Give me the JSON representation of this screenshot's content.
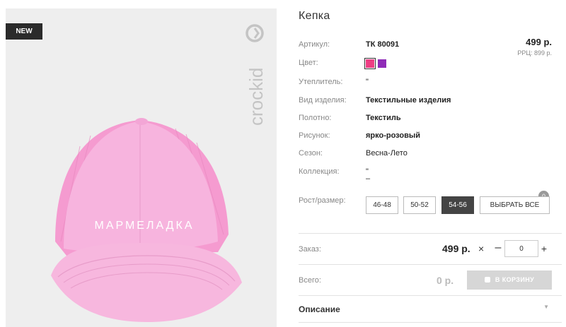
{
  "product": {
    "badge": "NEW",
    "brand_logo_text": "crockid",
    "cap_print_text": "МАРМЕЛАДКА",
    "title": "Кепка",
    "price": "499 р.",
    "rrp": "РРЦ: 899 р."
  },
  "specs": {
    "article": {
      "label": "Артикул:",
      "value": "ТК 80091"
    },
    "color": {
      "label": "Цвет:",
      "swatches": [
        "#ee3e84",
        "#8f2bb7"
      ]
    },
    "insulation": {
      "label": "Утеплитель:",
      "value": "\""
    },
    "type": {
      "label": "Вид изделия:",
      "value": "Текстильные изделия"
    },
    "fabric": {
      "label": "Полотно:",
      "value": "Текстиль"
    },
    "pattern": {
      "label": "Рисунок:",
      "value": "ярко-розовый"
    },
    "season": {
      "label": "Сезон:",
      "value": "Весна-Лето"
    },
    "collection": {
      "label": "Коллекция:",
      "value": "\"",
      "value2": "–"
    },
    "size": {
      "label": "Рост/размер:"
    }
  },
  "sizes": {
    "options": [
      "46-48",
      "50-52",
      "54-56"
    ],
    "selected": "54-56",
    "count": "0",
    "select_all": "ВЫБРАТЬ ВСЕ"
  },
  "order": {
    "label": "Заказ:",
    "price": "499 р.",
    "times": "×",
    "minus": "–",
    "plus": "+",
    "quantity": "0"
  },
  "total": {
    "label": "Всего:",
    "value": "0 р.",
    "cart_button": "В КОРЗИНУ"
  },
  "description": {
    "label": "Описание",
    "chevron": "▼"
  }
}
